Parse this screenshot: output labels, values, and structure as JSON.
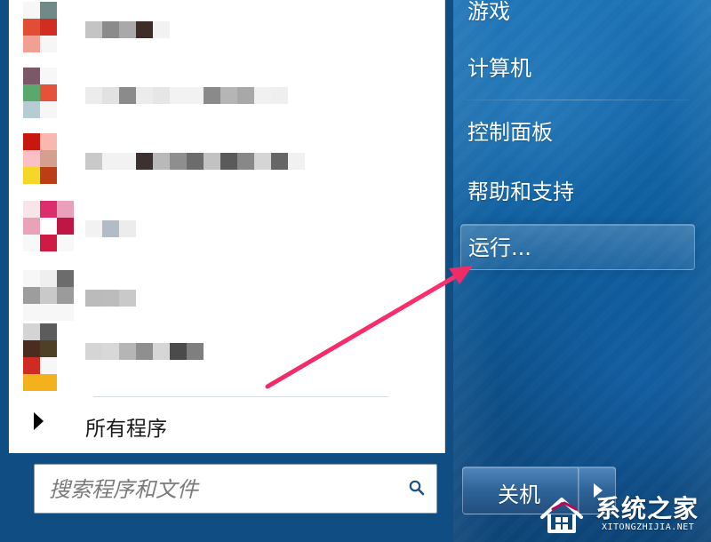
{
  "programs": [
    {
      "icon_cells": [
        [
          "#f7f7f7",
          "#718a88"
        ],
        [
          "#e24d36",
          "#d22d23"
        ],
        [
          "#f29f94",
          "#f6f6f6"
        ]
      ],
      "text_cells": [
        "#c4c4c4",
        "#8b8b8b",
        "#a9a9a9",
        "#3e2c28",
        "#f2f2f2"
      ]
    },
    {
      "icon_cells": [
        [
          "#7b5868",
          "#f7f7f7"
        ],
        [
          "#59a96f",
          "#e75039"
        ],
        [
          "#b7ccd2",
          "#f6f6f6"
        ]
      ],
      "text_cells": [
        "#ececec",
        "#e2e2e2",
        "#8b8b8b",
        "#ececec",
        "#e6e6e6",
        "#f2f2f2",
        "#f2f2f2",
        "#8a8a8a",
        "#b5b5b5",
        "#a8a8a8",
        "#f1f1f1",
        "#efefef"
      ]
    },
    {
      "icon_cells": [
        [
          "#c8170d",
          "#f8b8b0"
        ],
        [
          "#fac0c5",
          "#d59f90"
        ],
        [
          "#f4d729",
          "#bc3e14"
        ]
      ],
      "text_cells": [
        "#c9c9c9",
        "#f2f2f2",
        "#f2f2f2",
        "#3c3131",
        "#b9b9b9",
        "#8e8e8e",
        "#6c6c6c",
        "#c2c2c2",
        "#5a5a5a",
        "#888888",
        "#d5d5d5",
        "#666666",
        "#f1f1f1"
      ]
    },
    {
      "icon_cells": [
        [
          "#f8e5ea",
          "#dc2e6c",
          "#eaa0ba"
        ],
        [
          "#e9a2b7",
          "#ffffff",
          "#bf1745"
        ],
        [
          "#f8f8f8",
          "#cf1a46",
          "#f8f8f8"
        ]
      ],
      "text_cells": [
        "#f2f2f2",
        "#b1bcc6",
        "#ececec"
      ]
    },
    {
      "icon_cells": [
        [
          "#f7f7f7",
          "#efefef",
          "#6c6c6c"
        ],
        [
          "#9d9d9d",
          "#c9c9c9",
          "#9b9b9b"
        ],
        [
          "#f7f7f7",
          "#f7f7f7",
          "#f7f7f7"
        ]
      ],
      "text_cells": [
        "#bbbbbb",
        "#bcbcbc",
        "#c9c9c9"
      ]
    },
    {
      "icon_cells": [
        [
          "#d4d4d4",
          "#5c5c5c"
        ],
        [
          "#4b2d1f",
          "#4e4026"
        ],
        [
          "#ce2c22",
          "#f7f7f7"
        ],
        [
          "#f2b11d",
          "#f2b11d"
        ]
      ],
      "text_cells": [
        "#d5d5d5",
        "#d8d8d8",
        "#b5b5b5",
        "#8f8f8f",
        "#d6d6d6",
        "#4b4b4b",
        "#7f7f7f"
      ]
    }
  ],
  "all_programs_label": "所有程序",
  "search": {
    "placeholder": "搜索程序和文件",
    "value": ""
  },
  "right_menu": {
    "games": "游戏",
    "computer": "计算机",
    "control_panel": "控制面板",
    "help_support": "帮助和支持",
    "run": "运行..."
  },
  "shutdown": {
    "label": "关机"
  },
  "watermark": {
    "title": "系统之家",
    "domain": "XITONGZHIJIA.NET"
  },
  "colors": {
    "annotation_arrow": "#ef2b68",
    "left_panel_bg": "#ffffff",
    "right_panel_blue": "#0e5e9f",
    "shutdown_blue": "#2f6499"
  },
  "icons": {
    "search": "search-icon",
    "all_programs": "triangle-right-icon",
    "shutdown_menu": "chevron-right-icon",
    "annotation": "arrow-icon",
    "watermark_logo": "house-logo-icon"
  }
}
